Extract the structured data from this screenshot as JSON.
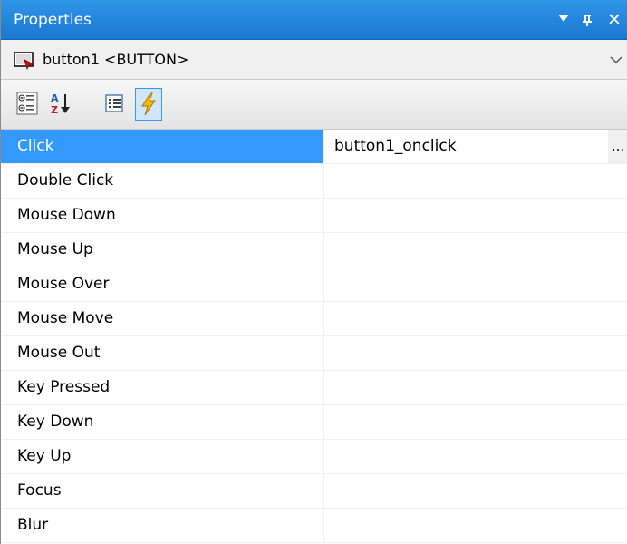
{
  "panel": {
    "title": "Properties"
  },
  "title_buttons": {
    "dropdown_icon": "triangle-down-icon",
    "pin_icon": "pin-icon",
    "close_label": "✕"
  },
  "object_selector": {
    "text": "button1 <BUTTON>",
    "icon": "button-control-icon"
  },
  "toolbar": {
    "buttons": [
      {
        "icon": "categorized-icon",
        "pressed": false
      },
      {
        "icon": "alphabetical-sort-icon",
        "pressed": false
      },
      {
        "icon": "properties-icon",
        "pressed": false
      },
      {
        "icon": "events-lightning-icon",
        "pressed": true
      }
    ]
  },
  "events": [
    {
      "name": "Click",
      "value": "button1_onclick",
      "selected": true,
      "has_ellipsis": true
    },
    {
      "name": "Double Click",
      "value": ""
    },
    {
      "name": "Mouse Down",
      "value": ""
    },
    {
      "name": "Mouse Up",
      "value": ""
    },
    {
      "name": "Mouse Over",
      "value": ""
    },
    {
      "name": "Mouse Move",
      "value": ""
    },
    {
      "name": "Mouse Out",
      "value": ""
    },
    {
      "name": "Key Pressed",
      "value": ""
    },
    {
      "name": "Key Down",
      "value": ""
    },
    {
      "name": "Key Up",
      "value": ""
    },
    {
      "name": "Focus",
      "value": ""
    },
    {
      "name": "Blur",
      "value": ""
    }
  ],
  "ellipsis_label": "...",
  "colors": {
    "titlebar": "#1a78d3",
    "selection": "#3399ff",
    "lightning": "#f5b800"
  }
}
